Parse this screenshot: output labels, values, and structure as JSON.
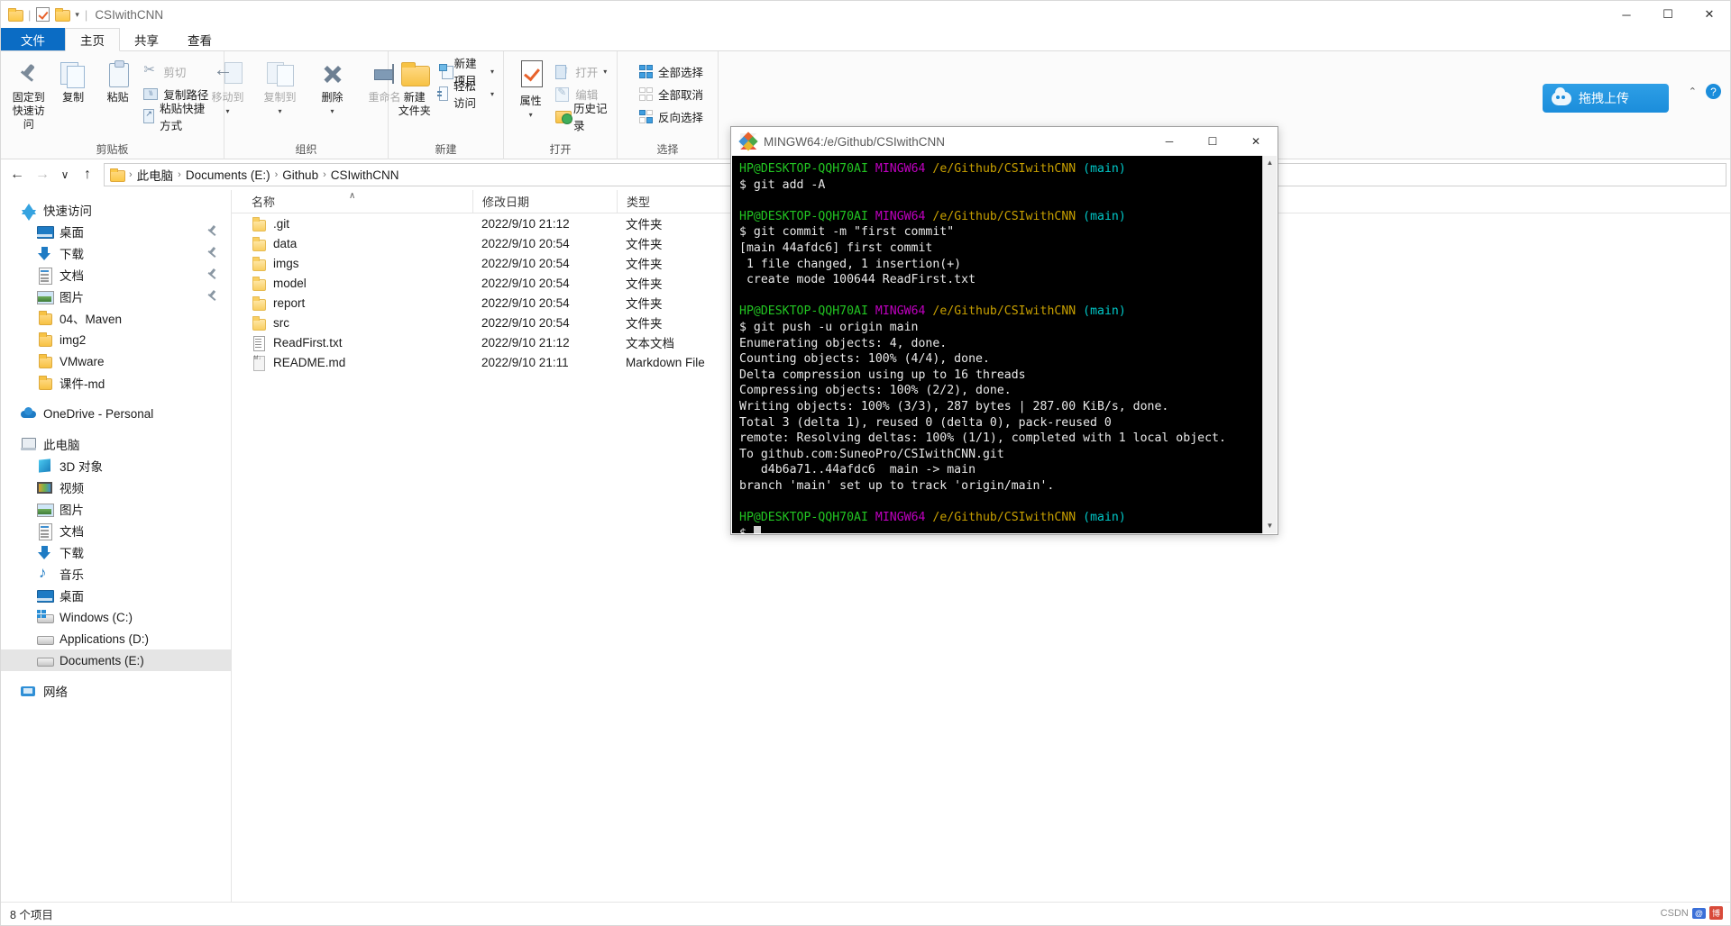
{
  "window": {
    "title": "CSIwithCNN",
    "minimize": "─",
    "maximize": "☐",
    "close": "✕"
  },
  "quick_access_toolbar": {
    "folder_icon": "folder-icon",
    "properties_icon": "properties-icon",
    "new_folder_icon": "new-folder-icon",
    "customize_caret": "▾"
  },
  "tabs": [
    {
      "label": "文件",
      "id": "file"
    },
    {
      "label": "主页",
      "id": "home"
    },
    {
      "label": "共享",
      "id": "share"
    },
    {
      "label": "查看",
      "id": "view"
    }
  ],
  "upload_pill": {
    "label": "拖拽上传",
    "color": "#1b8ddb"
  },
  "ribbon_corner": {
    "collapse": "⌃",
    "help": "?"
  },
  "ribbon": {
    "groups": [
      {
        "label": "剪贴板",
        "big": [
          {
            "label": "固定到\n快速访问",
            "line1": "固定到",
            "line2": "快速访问",
            "icon": "pin-icon",
            "disabled": false
          },
          {
            "label": "复制",
            "line1": "复制",
            "line2": "",
            "icon": "copy-icon",
            "disabled": false
          },
          {
            "label": "粘贴",
            "line1": "粘贴",
            "line2": "",
            "icon": "paste-icon",
            "disabled": false
          }
        ],
        "small": [
          {
            "label": "剪切",
            "icon": "scissors-icon",
            "disabled": true
          },
          {
            "label": "复制路径",
            "icon": "copy-path-icon",
            "disabled": false
          },
          {
            "label": "粘贴快捷方式",
            "icon": "paste-shortcut-icon",
            "disabled": false
          }
        ]
      },
      {
        "label": "组织",
        "big": [
          {
            "line1": "移动到",
            "line2": "",
            "icon": "move-to-icon",
            "disabled": true,
            "caret": true
          },
          {
            "line1": "复制到",
            "line2": "",
            "icon": "copy-to-icon",
            "disabled": true,
            "caret": true
          },
          {
            "line1": "删除",
            "line2": "",
            "icon": "delete-icon",
            "disabled": false,
            "caret": true
          },
          {
            "line1": "重命名",
            "line2": "",
            "icon": "rename-icon",
            "disabled": true
          }
        ],
        "small": []
      },
      {
        "label": "新建",
        "big": [
          {
            "line1": "新建",
            "line2": "文件夹",
            "icon": "new-folder-icon",
            "disabled": false
          }
        ],
        "small": [
          {
            "label": "新建项目",
            "icon": "new-item-icon",
            "disabled": false,
            "caret": true
          },
          {
            "label": "轻松访问",
            "icon": "easy-access-icon",
            "disabled": false,
            "caret": true
          }
        ]
      },
      {
        "label": "打开",
        "big": [
          {
            "line1": "属性",
            "line2": "",
            "icon": "properties-icon",
            "disabled": false,
            "caret": true
          }
        ],
        "small": [
          {
            "label": "打开",
            "icon": "open-icon",
            "disabled": true,
            "caret": true
          },
          {
            "label": "编辑",
            "icon": "edit-icon",
            "disabled": true
          },
          {
            "label": "历史记录",
            "icon": "history-icon",
            "disabled": false
          }
        ]
      },
      {
        "label": "选择",
        "big": [],
        "small": [
          {
            "label": "全部选择",
            "icon": "select-all-icon",
            "disabled": false
          },
          {
            "label": "全部取消",
            "icon": "select-none-icon",
            "disabled": false
          },
          {
            "label": "反向选择",
            "icon": "invert-selection-icon",
            "disabled": false
          }
        ]
      }
    ]
  },
  "addressbar": {
    "back": "←",
    "forward": "→",
    "recent": "∨",
    "up": "↑",
    "crumbs": [
      "此电脑",
      "Documents (E:)",
      "Github",
      "CSIwithCNN"
    ],
    "separator": "›"
  },
  "navpane": {
    "items": [
      {
        "label": "快速访问",
        "icon": "star-icon",
        "level": 0,
        "pinned": false,
        "selected": false
      },
      {
        "label": "桌面",
        "icon": "desktop-icon",
        "level": 1,
        "pinned": true,
        "selected": false
      },
      {
        "label": "下载",
        "icon": "downloads-icon",
        "level": 1,
        "pinned": true,
        "selected": false
      },
      {
        "label": "文档",
        "icon": "documents-icon",
        "level": 1,
        "pinned": true,
        "selected": false
      },
      {
        "label": "图片",
        "icon": "pictures-icon",
        "level": 1,
        "pinned": true,
        "selected": false
      },
      {
        "label": "04、Maven",
        "icon": "folder-icon",
        "level": 1,
        "pinned": false,
        "selected": false
      },
      {
        "label": "img2",
        "icon": "folder-icon",
        "level": 1,
        "pinned": false,
        "selected": false
      },
      {
        "label": "VMware",
        "icon": "folder-icon",
        "level": 1,
        "pinned": false,
        "selected": false
      },
      {
        "label": "课件-md",
        "icon": "folder-icon",
        "level": 1,
        "pinned": false,
        "selected": false
      },
      {
        "gap": true
      },
      {
        "label": "OneDrive - Personal",
        "icon": "onedrive-icon",
        "level": 0,
        "pinned": false,
        "selected": false
      },
      {
        "gap": true
      },
      {
        "label": "此电脑",
        "icon": "this-pc-icon",
        "level": 0,
        "pinned": false,
        "selected": false
      },
      {
        "label": "3D 对象",
        "icon": "3d-objects-icon",
        "level": 1,
        "pinned": false,
        "selected": false
      },
      {
        "label": "视频",
        "icon": "videos-icon",
        "level": 1,
        "pinned": false,
        "selected": false
      },
      {
        "label": "图片",
        "icon": "pictures-icon",
        "level": 1,
        "pinned": false,
        "selected": false
      },
      {
        "label": "文档",
        "icon": "documents-icon",
        "level": 1,
        "pinned": false,
        "selected": false
      },
      {
        "label": "下载",
        "icon": "downloads-icon",
        "level": 1,
        "pinned": false,
        "selected": false
      },
      {
        "label": "音乐",
        "icon": "music-icon",
        "level": 1,
        "pinned": false,
        "selected": false
      },
      {
        "label": "桌面",
        "icon": "desktop-icon",
        "level": 1,
        "pinned": false,
        "selected": false
      },
      {
        "label": "Windows (C:)",
        "icon": "windows-drive-icon",
        "level": 1,
        "pinned": false,
        "selected": false
      },
      {
        "label": "Applications (D:)",
        "icon": "drive-icon",
        "level": 1,
        "pinned": false,
        "selected": false
      },
      {
        "label": "Documents (E:)",
        "icon": "drive-icon",
        "level": 1,
        "pinned": false,
        "selected": true
      },
      {
        "gap": true
      },
      {
        "label": "网络",
        "icon": "network-icon",
        "level": 0,
        "pinned": false,
        "selected": false
      }
    ]
  },
  "filelist": {
    "columns": [
      {
        "label": "名称",
        "key": "name",
        "sorted": true,
        "sort_caret": "∧"
      },
      {
        "label": "修改日期",
        "key": "date"
      },
      {
        "label": "类型",
        "key": "type"
      }
    ],
    "rows": [
      {
        "name": ".git",
        "date": "2022/9/10 21:12",
        "type": "文件夹",
        "icon": "folder-icon"
      },
      {
        "name": "data",
        "date": "2022/9/10 20:54",
        "type": "文件夹",
        "icon": "folder-icon"
      },
      {
        "name": "imgs",
        "date": "2022/9/10 20:54",
        "type": "文件夹",
        "icon": "folder-icon"
      },
      {
        "name": "model",
        "date": "2022/9/10 20:54",
        "type": "文件夹",
        "icon": "folder-icon"
      },
      {
        "name": "report",
        "date": "2022/9/10 20:54",
        "type": "文件夹",
        "icon": "folder-icon"
      },
      {
        "name": "src",
        "date": "2022/9/10 20:54",
        "type": "文件夹",
        "icon": "folder-icon"
      },
      {
        "name": "ReadFirst.txt",
        "date": "2022/9/10 21:12",
        "type": "文本文档",
        "icon": "text-file-icon"
      },
      {
        "name": "README.md",
        "date": "2022/9/10 21:11",
        "type": "Markdown File",
        "icon": "markdown-file-icon"
      }
    ]
  },
  "statusbar": {
    "item_count": "8 个项目",
    "watermark": "CSDN",
    "badge1": "@",
    "badge2": "博"
  },
  "terminal": {
    "title": "MINGW64:/e/Github/CSIwithCNN",
    "icon": "git-bash-icon",
    "minimize": "─",
    "maximize": "☐",
    "close": "✕",
    "scroll_up": "▲",
    "scroll_down": "▼",
    "prompt": {
      "user_host": "HP@DESKTOP-QQH70AI",
      "shell": "MINGW64",
      "path": "/e/Github/CSIwithCNN",
      "branch": "(main)",
      "symbol": "$"
    },
    "lines": [
      {
        "type": "prompt"
      },
      {
        "type": "cmd",
        "text": "$ git add -A"
      },
      {
        "type": "blank"
      },
      {
        "type": "prompt"
      },
      {
        "type": "cmd",
        "text": "$ git commit -m \"first commit\""
      },
      {
        "type": "out",
        "text": "[main 44afdc6] first commit"
      },
      {
        "type": "out",
        "text": " 1 file changed, 1 insertion(+)"
      },
      {
        "type": "out",
        "text": " create mode 100644 ReadFirst.txt"
      },
      {
        "type": "blank"
      },
      {
        "type": "prompt"
      },
      {
        "type": "cmd",
        "text": "$ git push -u origin main"
      },
      {
        "type": "out",
        "text": "Enumerating objects: 4, done."
      },
      {
        "type": "out",
        "text": "Counting objects: 100% (4/4), done."
      },
      {
        "type": "out",
        "text": "Delta compression using up to 16 threads"
      },
      {
        "type": "out",
        "text": "Compressing objects: 100% (2/2), done."
      },
      {
        "type": "out",
        "text": "Writing objects: 100% (3/3), 287 bytes | 287.00 KiB/s, done."
      },
      {
        "type": "out",
        "text": "Total 3 (delta 1), reused 0 (delta 0), pack-reused 0"
      },
      {
        "type": "out",
        "text": "remote: Resolving deltas: 100% (1/1), completed with 1 local object."
      },
      {
        "type": "out",
        "text": "To github.com:SuneoPro/CSIwithCNN.git"
      },
      {
        "type": "out",
        "text": "   d4b6a71..44afdc6  main -> main"
      },
      {
        "type": "out",
        "text": "branch 'main' set up to track 'origin/main'."
      },
      {
        "type": "blank"
      },
      {
        "type": "prompt"
      },
      {
        "type": "cursor",
        "text": "$ "
      }
    ]
  }
}
